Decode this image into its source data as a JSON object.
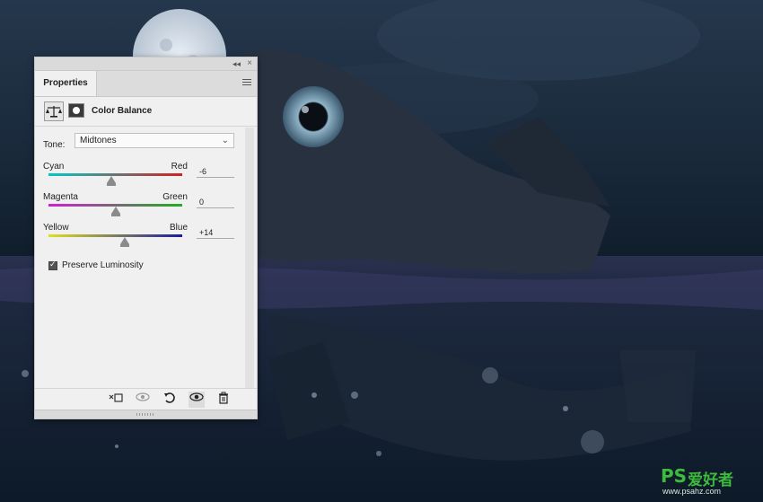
{
  "panel": {
    "tab_label": "Properties",
    "header_title": "Color Balance",
    "icons": {
      "adjustment": "balance-scale-icon",
      "mask": "layer-mask-icon",
      "collapse": "double-chevron-left-icon",
      "close": "close-icon",
      "menu": "panel-menu-icon"
    },
    "tone": {
      "label": "Tone:",
      "value": "Midtones"
    },
    "sliders": [
      {
        "left": "Cyan",
        "right": "Red",
        "value": "-6",
        "level": -6,
        "left_color": "#00c8c8",
        "right_color": "#d22020"
      },
      {
        "left": "Magenta",
        "right": "Green",
        "value": "0",
        "level": 0,
        "left_color": "#d020d0",
        "right_color": "#20b020"
      },
      {
        "left": "Yellow",
        "right": "Blue",
        "value": "+14",
        "level": 14,
        "left_color": "#e0e020",
        "right_color": "#1a1aa0"
      }
    ],
    "preserve_luminosity": {
      "label": "Preserve Luminosity",
      "checked": true
    },
    "footer_icons": [
      {
        "name": "clip-to-layer-icon"
      },
      {
        "name": "view-previous-state-icon"
      },
      {
        "name": "reset-icon"
      },
      {
        "name": "visibility-eye-icon"
      },
      {
        "name": "trash-icon"
      }
    ]
  },
  "watermark": {
    "ps": "PS",
    "cn": "爱好者",
    "url": "www.psahz.com"
  }
}
